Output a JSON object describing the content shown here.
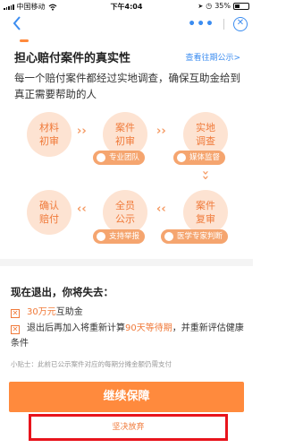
{
  "status_bar": {
    "carrier": "中国移动",
    "time": "下午4:04",
    "battery": "35%"
  },
  "nav": {
    "more": "•••",
    "close": "✕"
  },
  "header": {
    "title": "担心赔付案件的真实性",
    "past_link": "查看往期公示>"
  },
  "description": "每一个赔付案件都经过实地调查，确保互助金给到真正需要帮助的人",
  "process": {
    "steps": [
      {
        "line1": "材料",
        "line2": "初审"
      },
      {
        "line1": "案件",
        "line2": "初审"
      },
      {
        "line1": "实地",
        "line2": "调查"
      },
      {
        "line1": "案件",
        "line2": "复审"
      },
      {
        "line1": "全员",
        "line2": "公示"
      },
      {
        "line1": "确认",
        "line2": "赔付"
      }
    ],
    "tags": [
      "专业团队",
      "媒体监督",
      "支持举报",
      "医学专家判断"
    ]
  },
  "quit_section": {
    "title": "现在退出，你将失去：",
    "item1_amount": "30万元",
    "item1_text": "互助金",
    "item2_pre": "退出后再加入将重新计算",
    "item2_highlight": "90天等待期",
    "item2_post": "，并重新评估健康条件",
    "tip": "小贴士：此前已公示案件对应的每期分摊金额仍需支付"
  },
  "buttons": {
    "continue": "继续保障",
    "quit": "坚决放弃"
  }
}
